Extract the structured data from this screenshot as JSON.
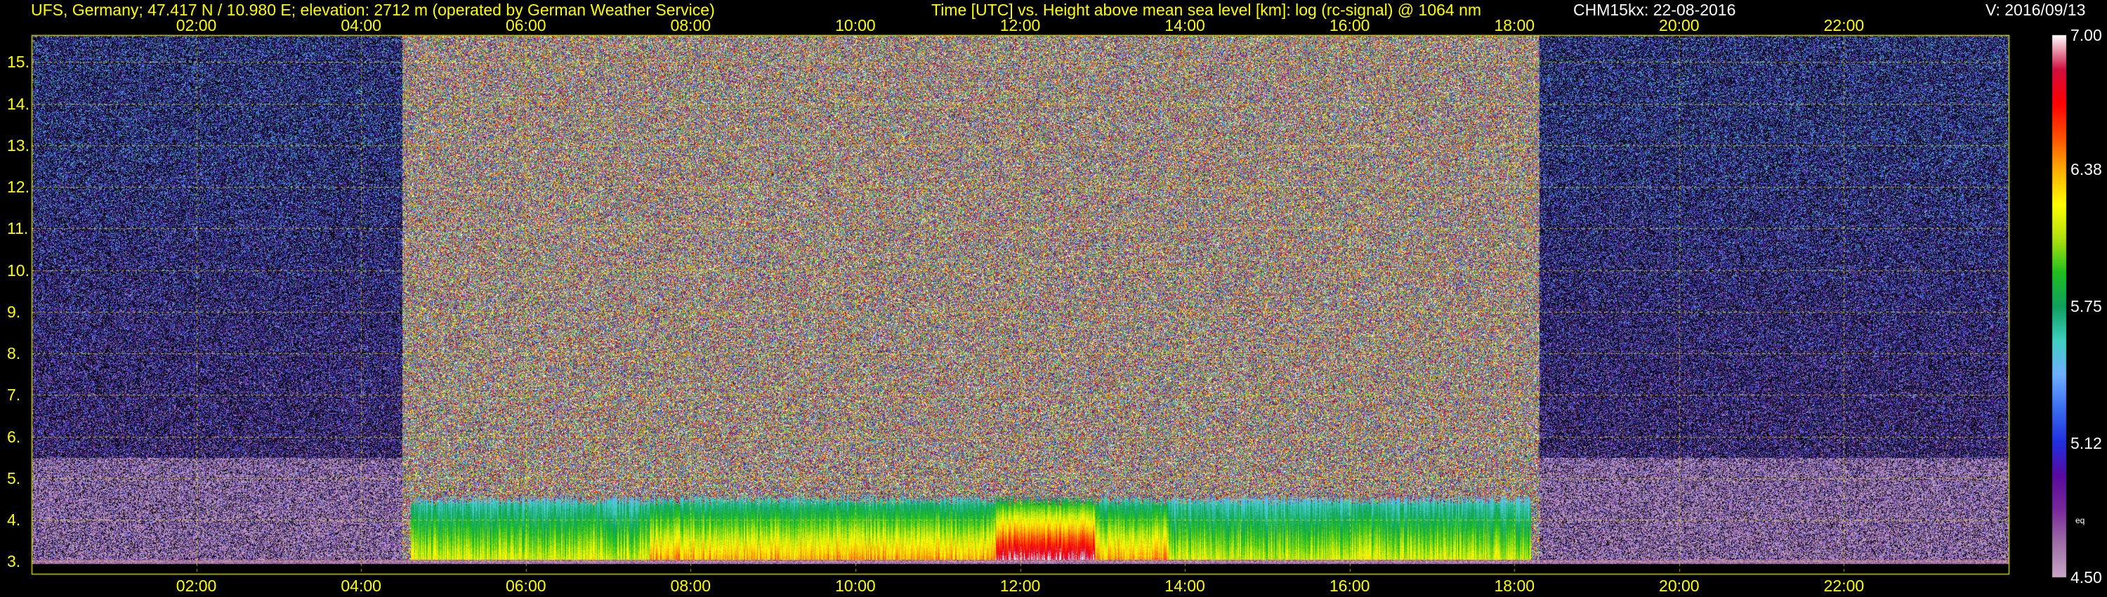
{
  "header": {
    "site": "UFS, Germany; 47.417 N / 10.980 E; elevation: 2712 m  (operated by German Weather Service)",
    "title": "Time [UTC] vs. Height above mean sea level [km]: log (rc-signal) @ 1064 nm",
    "instrument": "CHM15kx: 22-08-2016",
    "version": "V: 2016/09/13"
  },
  "colorbar": {
    "ticks": [
      "7.00",
      "6.38",
      "5.75",
      "5.12",
      "4.50"
    ],
    "tick_values": [
      7.0,
      6.38,
      5.75,
      5.12,
      4.5
    ],
    "small_label": "eq",
    "stops": [
      "#c8a8c8",
      "#a070a8",
      "#7a2a9a",
      "#5a0aa0",
      "#2030e0",
      "#3a70f0",
      "#70b0ff",
      "#40d0c0",
      "#10a060",
      "#20c020",
      "#b0e010",
      "#ffff00",
      "#ffb000",
      "#ff5000",
      "#ff0000",
      "#d01040",
      "#ffffff"
    ]
  },
  "chart_data": {
    "type": "heatmap",
    "title": "Time [UTC] vs. Height above mean sea level [km]: log (rc-signal) @ 1064 nm",
    "xlabel": "Time [UTC]",
    "ylabel": "Height above mean sea level [km]",
    "x_ticks": [
      "02:00",
      "04:00",
      "06:00",
      "08:00",
      "10:00",
      "12:00",
      "14:00",
      "16:00",
      "18:00",
      "20:00",
      "22:00"
    ],
    "x_tick_hours": [
      2,
      4,
      6,
      8,
      10,
      12,
      14,
      16,
      18,
      20,
      22
    ],
    "xlim_hours": [
      0,
      24
    ],
    "y_ticks": [
      "3.",
      "4.",
      "5.",
      "6.",
      "7.",
      "8.",
      "9.",
      "10.",
      "11.",
      "12.",
      "13.",
      "14.",
      "15."
    ],
    "y_tick_values": [
      3,
      4,
      5,
      6,
      7,
      8,
      9,
      10,
      11,
      12,
      13,
      14,
      15
    ],
    "ylim_km": [
      2.7,
      15.65
    ],
    "color_range": [
      4.5,
      7.0
    ],
    "grid": true,
    "features": {
      "daytime_noise_hours": [
        4.5,
        18.3
      ],
      "boundary_layer_top_km": 4.6,
      "aerosol_layer_hours": [
        4.6,
        18.2
      ]
    }
  }
}
